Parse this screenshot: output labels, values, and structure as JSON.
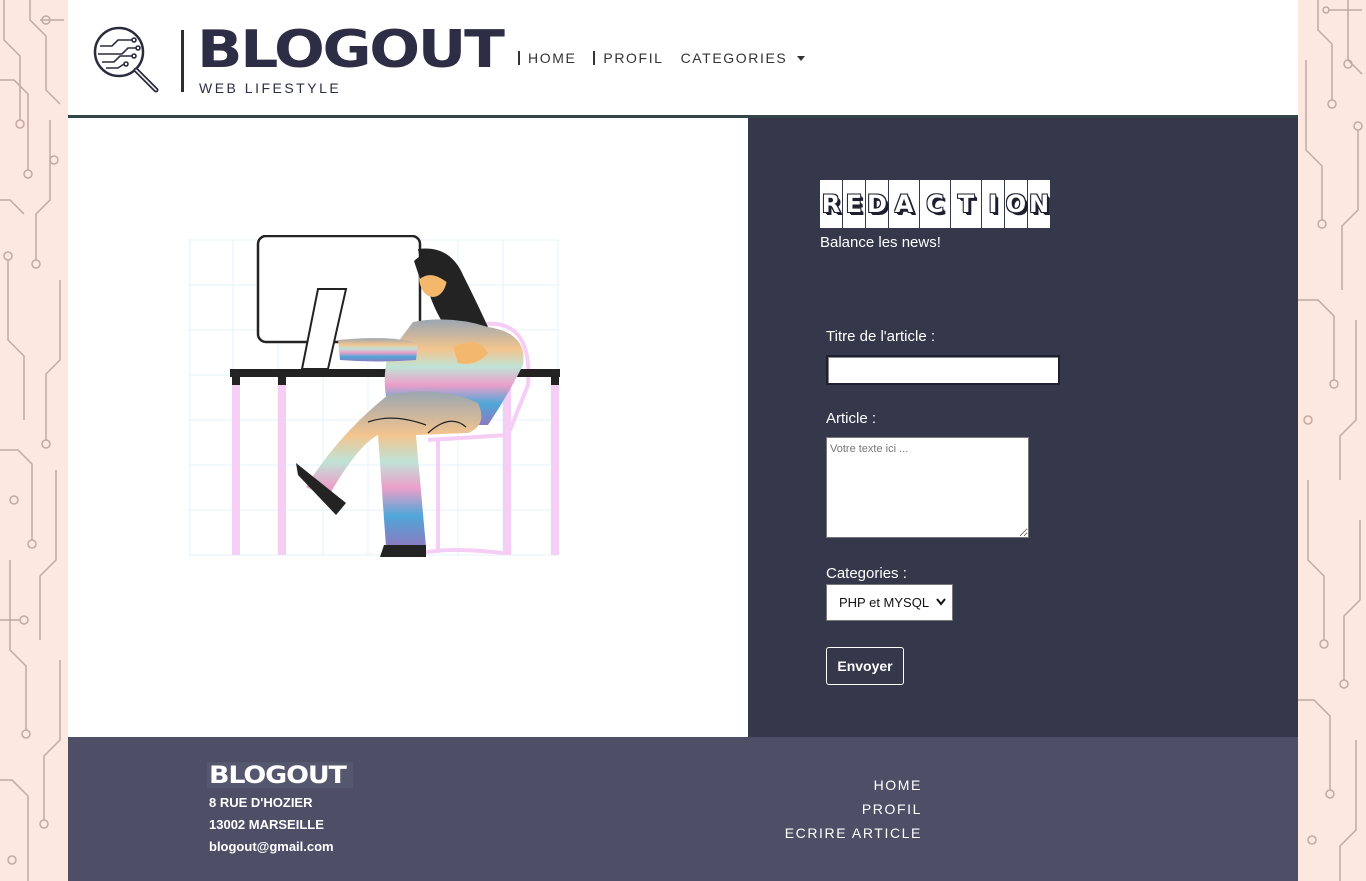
{
  "header": {
    "logo_title": "BLOGOUT",
    "logo_subtitle": "WEB LIFESTYLE",
    "nav": {
      "home": "HOME",
      "profil": "PROFIL",
      "categories": "CATEGORIES"
    }
  },
  "panel": {
    "heading_letters": [
      "R",
      "E",
      "D",
      "A",
      "C",
      "T",
      "I",
      "O",
      "N"
    ],
    "tagline": "Balance les news!",
    "form": {
      "title_label": "Titre de l'article :",
      "title_value": "",
      "article_label": "Article :",
      "article_placeholder": "Votre texte ici ...",
      "categories_label": "Categories :",
      "categories_selected": "PHP et MYSQL",
      "submit_label": "Envoyer"
    }
  },
  "footer": {
    "logo": "BLOGOUT",
    "address_line1": "8 RUE D'HOZIER",
    "address_line2": "13002 MARSEILLE",
    "email": "blogout@gmail.com",
    "links": {
      "home": "HOME",
      "profil": "PROFIL",
      "ecrire": "ECRIRE ARTICLE"
    }
  },
  "colors": {
    "panel_bg": "#35374b",
    "footer_bg": "#4e4f67",
    "side_bg": "#fce8de",
    "circuit_line": "#c2a9a0"
  }
}
